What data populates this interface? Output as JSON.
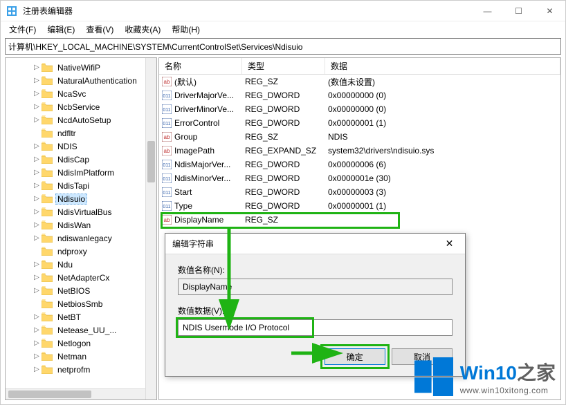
{
  "window": {
    "title": "注册表编辑器",
    "controls": {
      "min": "—",
      "max": "☐",
      "close": "✕"
    }
  },
  "menu": [
    "文件(F)",
    "编辑(E)",
    "查看(V)",
    "收藏夹(A)",
    "帮助(H)"
  ],
  "address": "计算机\\HKEY_LOCAL_MACHINE\\SYSTEM\\CurrentControlSet\\Services\\Ndisuio",
  "tree": {
    "items": [
      {
        "label": "NativeWifiP",
        "expandable": true
      },
      {
        "label": "NaturalAuthentication",
        "expandable": true
      },
      {
        "label": "NcaSvc",
        "expandable": true
      },
      {
        "label": "NcbService",
        "expandable": true
      },
      {
        "label": "NcdAutoSetup",
        "expandable": true
      },
      {
        "label": "ndfltr",
        "expandable": false
      },
      {
        "label": "NDIS",
        "expandable": true
      },
      {
        "label": "NdisCap",
        "expandable": true
      },
      {
        "label": "NdisImPlatform",
        "expandable": true
      },
      {
        "label": "NdisTapi",
        "expandable": true
      },
      {
        "label": "Ndisuio",
        "expandable": true,
        "selected": true
      },
      {
        "label": "NdisVirtualBus",
        "expandable": true
      },
      {
        "label": "NdisWan",
        "expandable": true
      },
      {
        "label": "ndiswanlegacy",
        "expandable": true
      },
      {
        "label": "ndproxy",
        "expandable": false
      },
      {
        "label": "Ndu",
        "expandable": true
      },
      {
        "label": "NetAdapterCx",
        "expandable": true
      },
      {
        "label": "NetBIOS",
        "expandable": true
      },
      {
        "label": "NetbiosSmb",
        "expandable": false
      },
      {
        "label": "NetBT",
        "expandable": true
      },
      {
        "label": "Netease_UU_...",
        "expandable": true
      },
      {
        "label": "Netlogon",
        "expandable": true
      },
      {
        "label": "Netman",
        "expandable": true
      },
      {
        "label": "netprofm",
        "expandable": true
      }
    ]
  },
  "list": {
    "columns": {
      "name": "名称",
      "type": "类型",
      "data": "数据"
    },
    "rows": [
      {
        "icon": "str",
        "name": "(默认)",
        "type": "REG_SZ",
        "data": "(数值未设置)"
      },
      {
        "icon": "bin",
        "name": "DriverMajorVe...",
        "type": "REG_DWORD",
        "data": "0x00000000 (0)"
      },
      {
        "icon": "bin",
        "name": "DriverMinorVe...",
        "type": "REG_DWORD",
        "data": "0x00000000 (0)"
      },
      {
        "icon": "bin",
        "name": "ErrorControl",
        "type": "REG_DWORD",
        "data": "0x00000001 (1)"
      },
      {
        "icon": "str",
        "name": "Group",
        "type": "REG_SZ",
        "data": "NDIS"
      },
      {
        "icon": "str",
        "name": "ImagePath",
        "type": "REG_EXPAND_SZ",
        "data": "system32\\drivers\\ndisuio.sys"
      },
      {
        "icon": "bin",
        "name": "NdisMajorVer...",
        "type": "REG_DWORD",
        "data": "0x00000006 (6)"
      },
      {
        "icon": "bin",
        "name": "NdisMinorVer...",
        "type": "REG_DWORD",
        "data": "0x0000001e (30)"
      },
      {
        "icon": "bin",
        "name": "Start",
        "type": "REG_DWORD",
        "data": "0x00000003 (3)"
      },
      {
        "icon": "bin",
        "name": "Type",
        "type": "REG_DWORD",
        "data": "0x00000001 (1)"
      },
      {
        "icon": "str",
        "name": "DisplayName",
        "type": "REG_SZ",
        "data": ""
      }
    ]
  },
  "dialog": {
    "title": "编辑字符串",
    "name_label": "数值名称(N):",
    "name_value": "DisplayName",
    "data_label": "数值数据(V):",
    "data_value": "NDIS Usermode I/O Protocol",
    "ok": "确定",
    "cancel": "取消"
  },
  "watermark": {
    "brand_a": "Win10",
    "brand_b": "之家",
    "url": "www.win10xitong.com"
  }
}
